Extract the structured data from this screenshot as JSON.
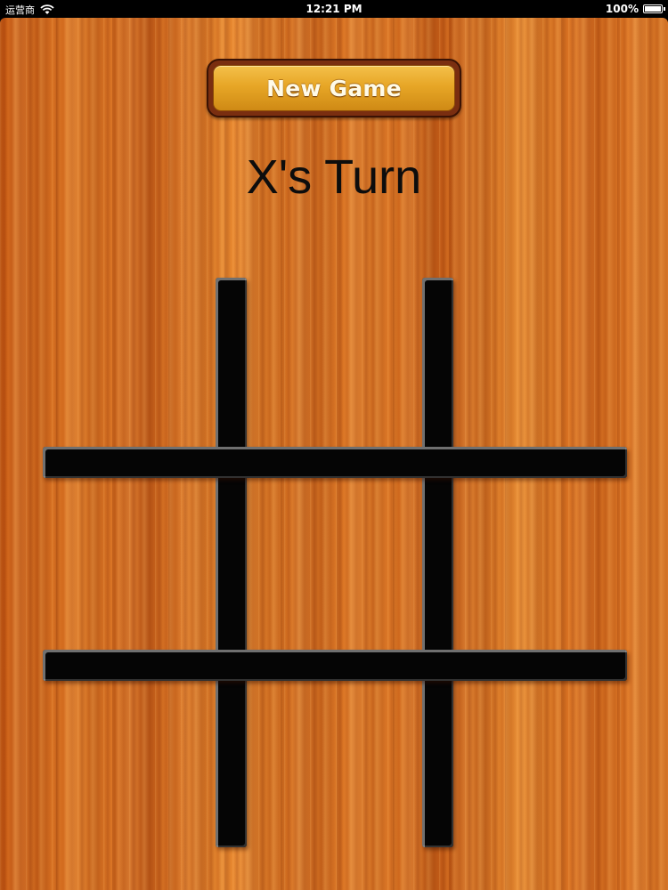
{
  "status_bar": {
    "carrier": "运营商",
    "time": "12:21 PM",
    "battery": "100%",
    "battery_level": 1.0,
    "wifi_icon": "wifi-icon",
    "battery_icon": "battery-icon"
  },
  "game": {
    "new_game_label": "New Game",
    "turn_text": "X's Turn",
    "cells": [
      "",
      "",
      "",
      "",
      "",
      "",
      "",
      "",
      ""
    ]
  },
  "colors": {
    "wood": "#d2661b",
    "button_gold": "#e7a626",
    "grid_line": "#050505",
    "turn_text": "#0d0d0d"
  }
}
